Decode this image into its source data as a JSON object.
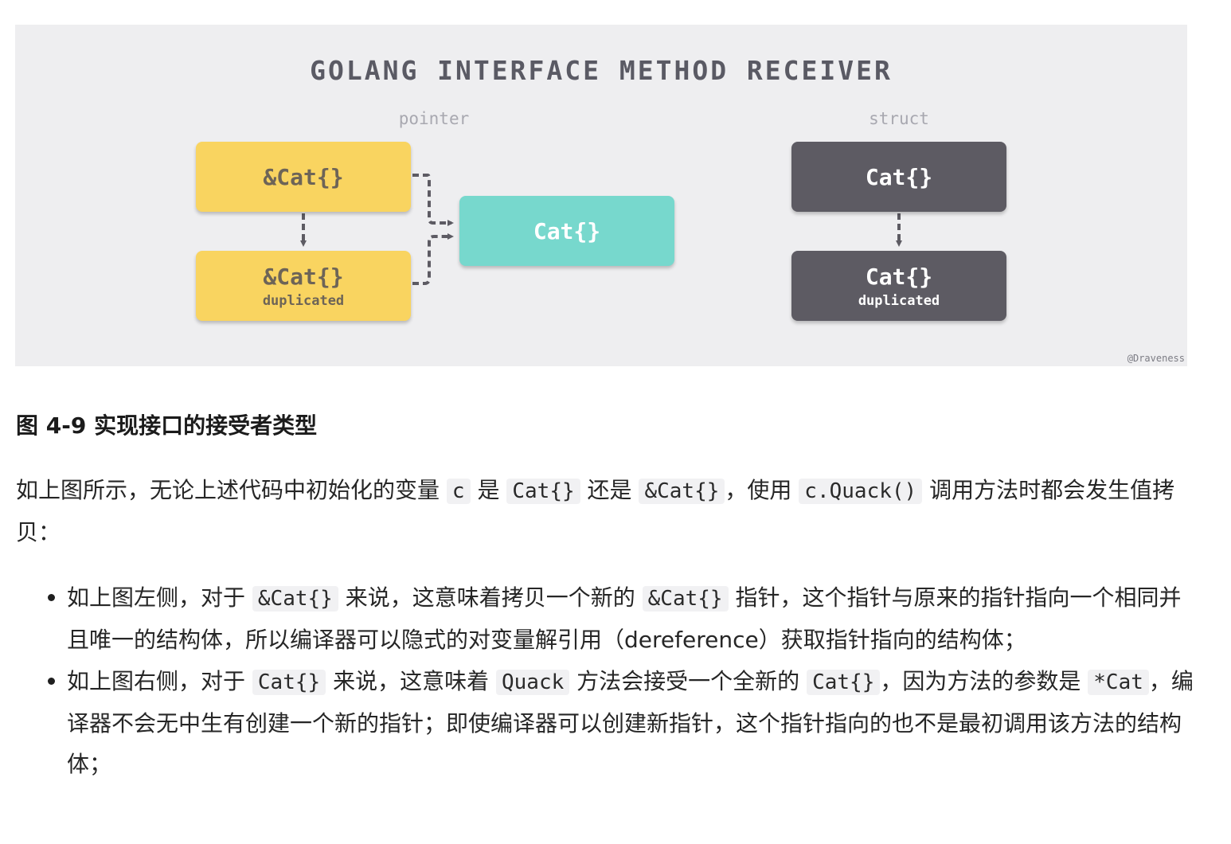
{
  "figure": {
    "title": "GOLANG INTERFACE METHOD RECEIVER",
    "pointer_label": "pointer",
    "struct_label": "struct",
    "boxes": {
      "ptr_top": "&Cat{}",
      "ptr_dup": "&Cat{}",
      "ptr_dup_sub": "duplicated",
      "target": "Cat{}",
      "struct_top": "Cat{}",
      "struct_dup": "Cat{}",
      "struct_dup_sub": "duplicated"
    },
    "credit": "@Draveness",
    "colors": {
      "pointer_box": "#f9d460",
      "target_box": "#77d8cd",
      "struct_box": "#5d5b63",
      "background": "#eeeef0"
    }
  },
  "caption": "图 4-9 实现接口的接受者类型",
  "paragraph": {
    "t1": "如上图所示，无论上述代码中初始化的变量 ",
    "c1": "c",
    "t2": " 是 ",
    "c2": "Cat{}",
    "t3": " 还是 ",
    "c3": "&Cat{}",
    "t4": "，使用 ",
    "c4": "c.Quack()",
    "t5": " 调用方法时都会发生值拷贝："
  },
  "bullets": {
    "b1": {
      "t1": "如上图左侧，对于 ",
      "c1": "&Cat{}",
      "t2": " 来说，这意味着拷贝一个新的 ",
      "c2": "&Cat{}",
      "t3": " 指针，这个指针与原来的指针指向一个相同并且唯一的结构体，所以编译器可以隐式的对变量解引用（dereference）获取指针指向的结构体；"
    },
    "b2": {
      "t1": "如上图右侧，对于 ",
      "c1": "Cat{}",
      "t2": " 来说，这意味着 ",
      "c2": "Quack",
      "t3": " 方法会接受一个全新的 ",
      "c3": "Cat{}",
      "t4": "，因为方法的参数是 ",
      "c4": "*Cat",
      "t5": "，编译器不会无中生有创建一个新的指针；即使编译器可以创建新指针，这个指针指向的也不是最初调用该方法的结构体；"
    }
  }
}
